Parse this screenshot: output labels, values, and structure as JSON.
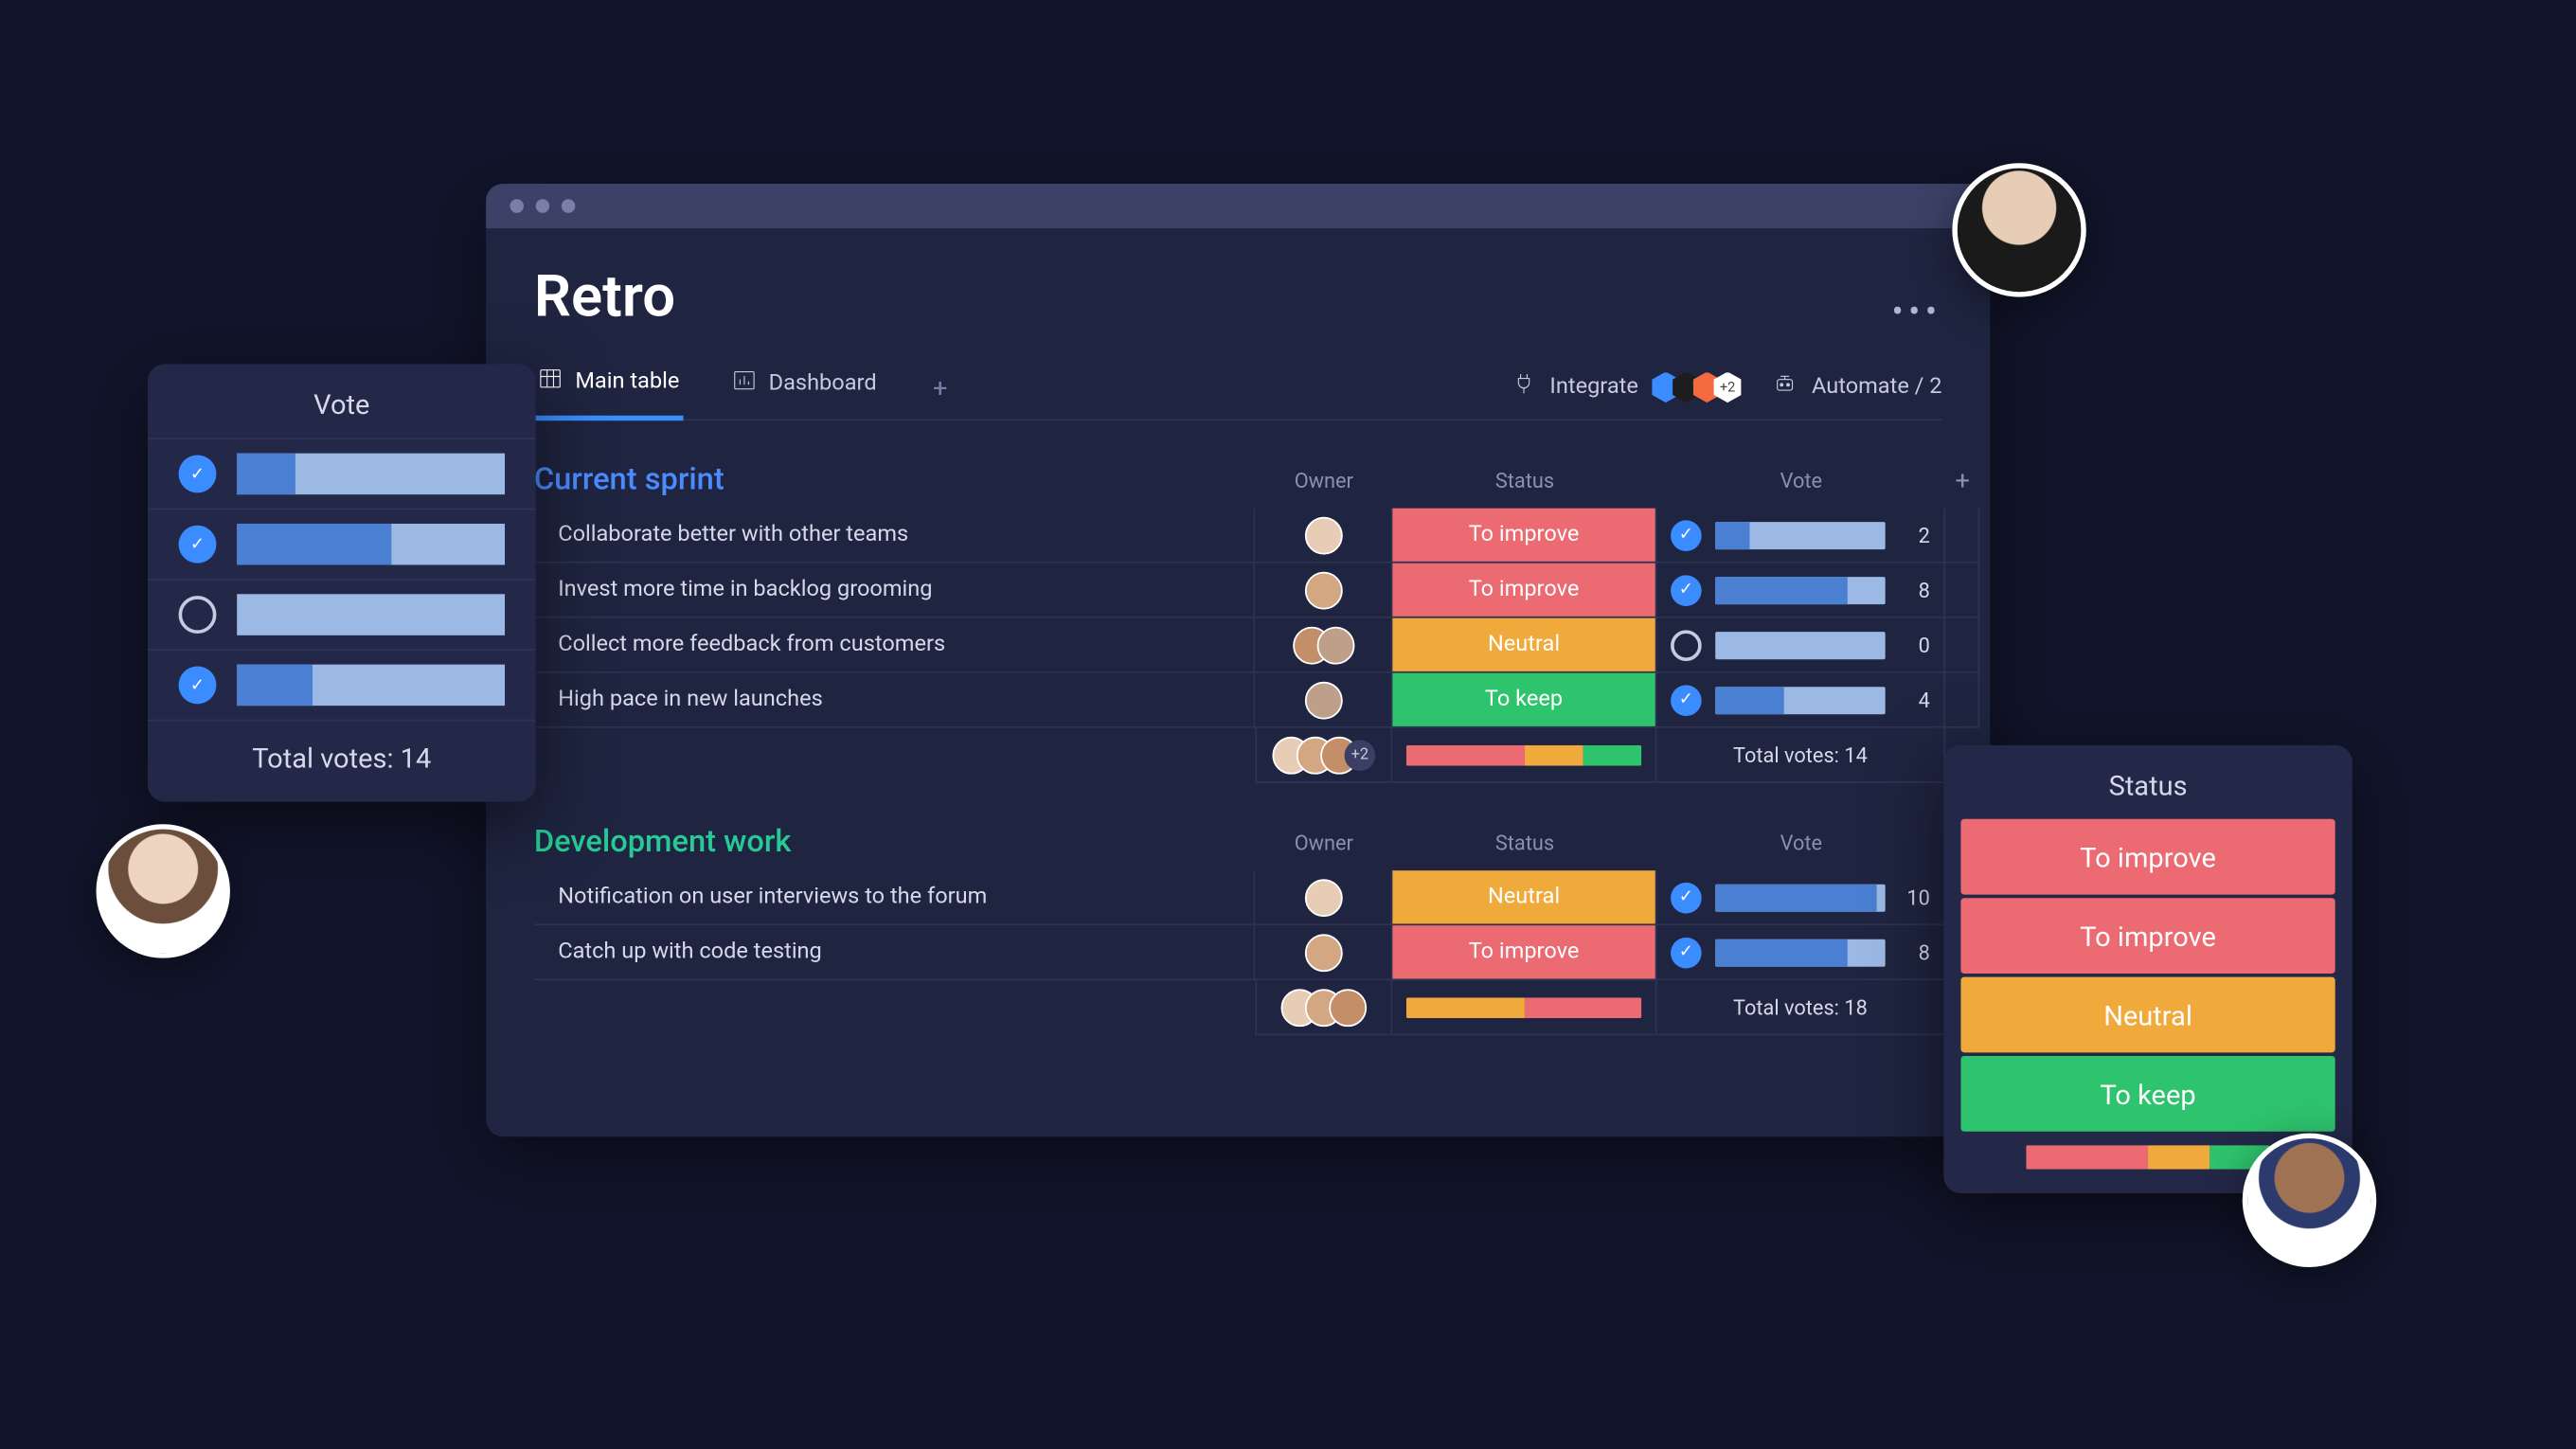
{
  "board": {
    "title": "Retro",
    "more_label": "•••",
    "tabs": [
      {
        "label": "Main table",
        "active": true,
        "icon": "table"
      },
      {
        "label": "Dashboard",
        "active": false,
        "icon": "chart"
      }
    ],
    "toolbar": {
      "integrate_label": "Integrate",
      "integrations_overflow": "+2",
      "automate_label": "Automate / 2"
    },
    "columns": {
      "owner": "Owner",
      "status": "Status",
      "vote": "Vote"
    },
    "groups": [
      {
        "id": "cs",
        "name": "Current sprint",
        "accent": "#4a8cff",
        "rows": [
          {
            "name": "Collaborate better with other teams",
            "owner_count": 1,
            "status": "To improve",
            "status_kind": "improve",
            "voted": true,
            "votes": 2,
            "fill": 20
          },
          {
            "name": "Invest more time in backlog grooming",
            "owner_count": 1,
            "status": "To improve",
            "status_kind": "improve",
            "voted": true,
            "votes": 8,
            "fill": 78
          },
          {
            "name": "Collect more feedback from customers",
            "owner_count": 2,
            "status": "Neutral",
            "status_kind": "neutral",
            "voted": false,
            "votes": 0,
            "fill": 0
          },
          {
            "name": "High pace in new  launches",
            "owner_count": 1,
            "status": "To keep",
            "status_kind": "keep",
            "voted": true,
            "votes": 4,
            "fill": 40
          }
        ],
        "summary": {
          "owners_overflow": "+2",
          "status_segments": [
            {
              "kind": "improve",
              "pct": 50
            },
            {
              "kind": "neutral",
              "pct": 25
            },
            {
              "kind": "keep",
              "pct": 25
            }
          ],
          "votes_total_label": "Total votes: 14"
        }
      },
      {
        "id": "dw",
        "name": "Development work",
        "accent": "#27c994",
        "rows": [
          {
            "name": "Notification on user interviews to the forum",
            "owner_count": 1,
            "status": "Neutral",
            "status_kind": "neutral",
            "voted": true,
            "votes": 10,
            "fill": 95
          },
          {
            "name": "Catch up with code testing",
            "owner_count": 1,
            "status": "To improve",
            "status_kind": "improve",
            "voted": true,
            "votes": 8,
            "fill": 78
          }
        ],
        "summary": {
          "owners_overflow": "",
          "status_segments": [
            {
              "kind": "neutral",
              "pct": 50
            },
            {
              "kind": "improve",
              "pct": 50
            }
          ],
          "votes_total_label": "Total votes: 18"
        }
      }
    ]
  },
  "vote_popup": {
    "title": "Vote",
    "rows": [
      {
        "voted": true,
        "fill": 22
      },
      {
        "voted": true,
        "fill": 58
      },
      {
        "voted": false,
        "fill": 0
      },
      {
        "voted": true,
        "fill": 28
      }
    ],
    "total_label": "Total votes: 14"
  },
  "status_popup": {
    "title": "Status",
    "options": [
      {
        "label": "To improve",
        "kind": "improve"
      },
      {
        "label": "To improve",
        "kind": "improve"
      },
      {
        "label": "Neutral",
        "kind": "neutral"
      },
      {
        "label": "To keep",
        "kind": "keep"
      }
    ],
    "segments": [
      {
        "kind": "improve",
        "pct": 50
      },
      {
        "kind": "neutral",
        "pct": 25
      },
      {
        "kind": "keep",
        "pct": 25
      }
    ]
  },
  "colors": {
    "improve": "#ec6b72",
    "neutral": "#f0a93b",
    "keep": "#2ec36d",
    "integration_badges": [
      "#3a8cff",
      "#1d1d1d",
      "#f26a3d",
      "#ffffff"
    ]
  }
}
